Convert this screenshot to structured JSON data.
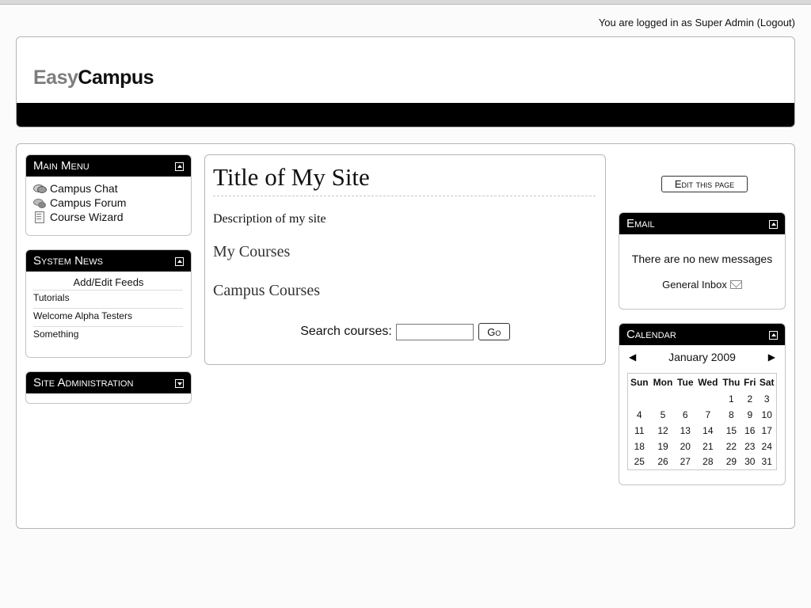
{
  "auth": {
    "prefix": "You are logged in as",
    "user": "Super Admin",
    "logout": "(Logout)"
  },
  "header": {
    "logo_part1": "Easy",
    "logo_part2": "Campus"
  },
  "main_menu": {
    "title": "Main Menu",
    "items": [
      {
        "label": "Campus Chat",
        "icon": "chat-icon"
      },
      {
        "label": "Campus Forum",
        "icon": "forum-icon"
      },
      {
        "label": "Course Wizard",
        "icon": "wizard-icon"
      }
    ]
  },
  "system_news": {
    "title": "System News",
    "feeds_link": "Add/Edit Feeds",
    "items": [
      "Tutorials",
      "Welcome Alpha Testers",
      "Something"
    ]
  },
  "site_admin": {
    "title": "Site Administration"
  },
  "content": {
    "site_title": "Title of My Site",
    "description": "Description of my site",
    "my_courses": "My Courses",
    "campus_courses": "Campus Courses",
    "search_label": "Search courses:",
    "search_value": "",
    "go_button": "Go"
  },
  "edit_page_button": "Edit this page",
  "email": {
    "title": "Email",
    "message": "There are no new messages",
    "inbox_link": "General Inbox"
  },
  "calendar": {
    "title": "Calendar",
    "month": "January 2009",
    "prev": "◀",
    "next": "▶",
    "days": [
      "Sun",
      "Mon",
      "Tue",
      "Wed",
      "Thu",
      "Fri",
      "Sat"
    ],
    "weeks": [
      [
        "",
        "",
        "",
        "",
        "1",
        "2",
        "3"
      ],
      [
        "4",
        "5",
        "6",
        "7",
        "8",
        "9",
        "10"
      ],
      [
        "11",
        "12",
        "13",
        "14",
        "15",
        "16",
        "17"
      ],
      [
        "18",
        "19",
        "20",
        "21",
        "22",
        "23",
        "24"
      ],
      [
        "25",
        "26",
        "27",
        "28",
        "29",
        "30",
        "31"
      ]
    ]
  }
}
